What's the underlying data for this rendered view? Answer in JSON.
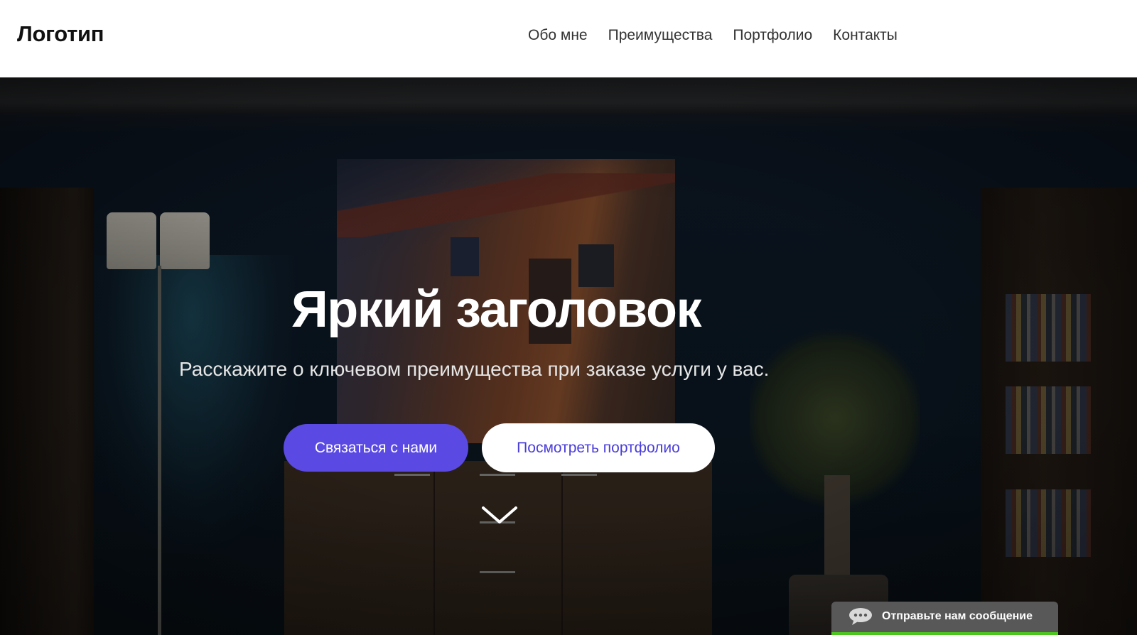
{
  "header": {
    "logo": "Логотип",
    "nav": [
      {
        "label": "Обо мне"
      },
      {
        "label": "Преимущества"
      },
      {
        "label": "Портфолио"
      },
      {
        "label": "Контакты"
      }
    ]
  },
  "hero": {
    "title": "Яркий заголовок",
    "subtitle": "Расскажите о ключевом преимущества при заказе услуги у вас.",
    "primary_button": "Связаться с нами",
    "secondary_button": "Посмотреть портфолио",
    "scroll_icon": "chevron-down-icon"
  },
  "chat": {
    "label": "Отправьте нам сообщение",
    "icon": "chat-bubble-icon"
  },
  "colors": {
    "accent": "#5a4ae3",
    "header_bg": "#ffffff",
    "chat_bg": "#585858",
    "chat_accent": "#4cc51f"
  }
}
